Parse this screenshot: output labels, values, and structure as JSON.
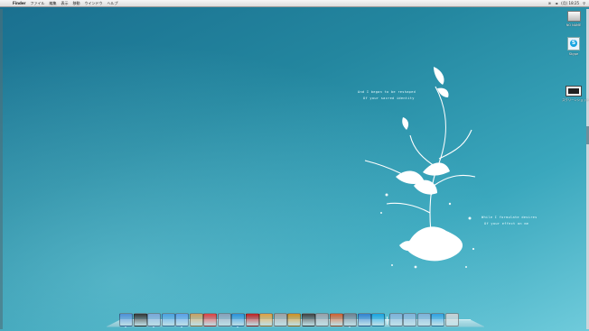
{
  "menubar": {
    "app_name": "Finder",
    "menus": [
      "ファイル",
      "編集",
      "表示",
      "移動",
      "ウインドウ",
      "ヘルプ"
    ],
    "clock": "(月) 18:25"
  },
  "desktop_icons": [
    {
      "label": "NO NAME",
      "icon": "hard-drive-icon"
    },
    {
      "label": "Skype",
      "icon": "skype-icon"
    },
    {
      "label": "スクリーンショット 20...11.22",
      "icon": "screenshot-file-icon"
    }
  ],
  "wallpaper_text": {
    "quote_top": [
      "And I began to be reshaped",
      "Of your sacred identity"
    ],
    "quote_bottom": [
      "While I formulate desires",
      "Of your effect on me"
    ]
  },
  "dock": {
    "apps": [
      {
        "name": "finder-icon",
        "color": "#4e8fd6"
      },
      {
        "name": "dashboard-icon",
        "color": "#333333"
      },
      {
        "name": "mail-icon",
        "color": "#7aa6d8"
      },
      {
        "name": "safari-icon",
        "color": "#4aa0e0"
      },
      {
        "name": "ichat-icon",
        "color": "#5aa0e8"
      },
      {
        "name": "address-book-icon",
        "color": "#c8a060"
      },
      {
        "name": "ical-icon",
        "color": "#e04040"
      },
      {
        "name": "preview-icon",
        "color": "#8aa0b8"
      },
      {
        "name": "itunes-icon",
        "color": "#2a90d8"
      },
      {
        "name": "photo-booth-icon",
        "color": "#c02020"
      },
      {
        "name": "iphoto-icon",
        "color": "#e0a040"
      },
      {
        "name": "imovie-icon",
        "color": "#a0a0a0"
      },
      {
        "name": "garageband-icon",
        "color": "#d09020"
      },
      {
        "name": "time-machine-icon",
        "color": "#404040"
      },
      {
        "name": "system-preferences-icon",
        "color": "#9aa0a8"
      },
      {
        "name": "text-edit-icon",
        "color": "#d06030"
      },
      {
        "name": "automator-icon",
        "color": "#708090"
      },
      {
        "name": "app-store-icon",
        "color": "#3080d0"
      },
      {
        "name": "skype-dock-icon",
        "color": "#17a3e0"
      }
    ],
    "stacks": [
      {
        "name": "applications-folder-icon",
        "color": "#7fb0d8"
      },
      {
        "name": "documents-folder-icon",
        "color": "#7fb0d8"
      },
      {
        "name": "downloads-folder-icon",
        "color": "#7fb0d8"
      },
      {
        "name": "app-store-stack-icon",
        "color": "#30a0e0"
      },
      {
        "name": "trash-icon",
        "color": "#c8d0d4"
      }
    ]
  }
}
